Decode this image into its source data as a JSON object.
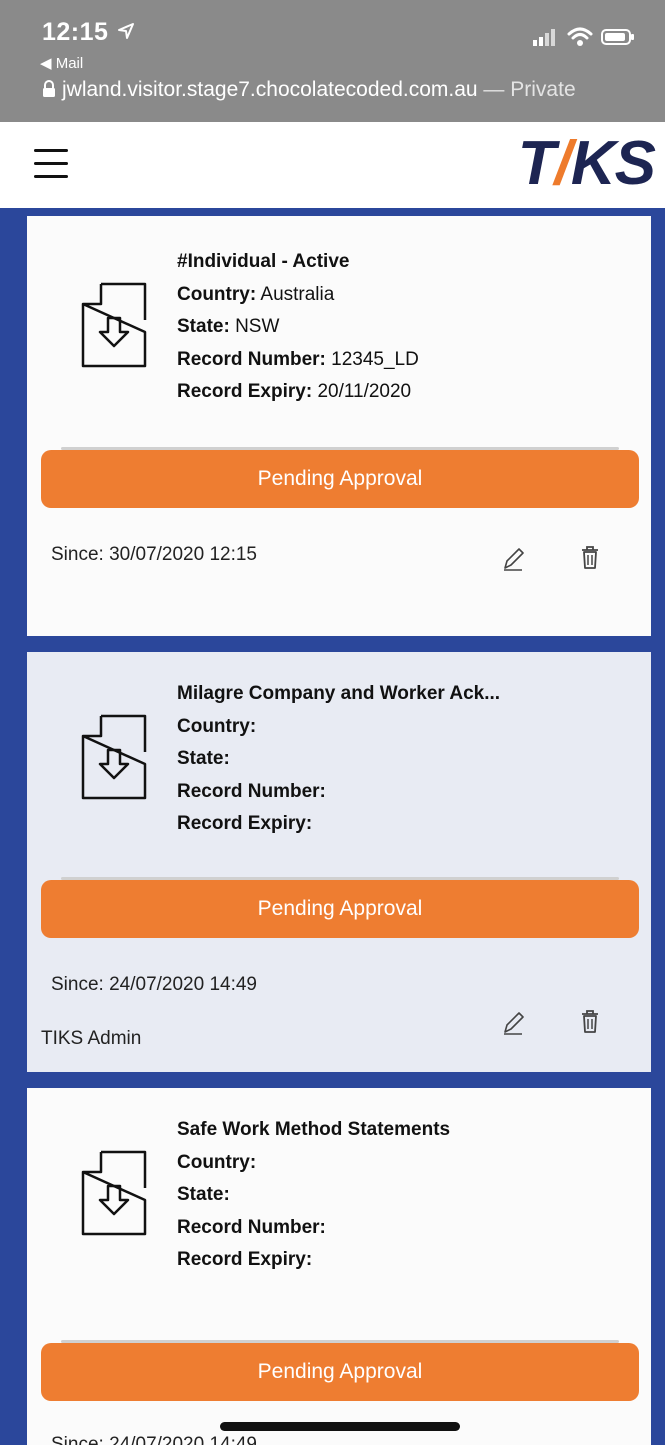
{
  "status_bar": {
    "time": "12:15",
    "back_label": "◀ Mail",
    "url": "jwland.visitor.stage7.chocolatecoded.com.au",
    "url_suffix": " — Private"
  },
  "header": {
    "logo_left": "T",
    "logo_slash": "/",
    "logo_right": "KS",
    "accent_color": "#ee7b2c",
    "brand_color": "#1d2552"
  },
  "records": [
    {
      "title": "#Individual - Active",
      "country_label": "Country:",
      "country": "Australia",
      "state_label": "State:",
      "state": "NSW",
      "number_label": "Record Number:",
      "number": "12345_LD",
      "expiry_label": "Record Expiry:",
      "expiry": "20/11/2020",
      "status": "Pending Approval",
      "since": "Since: 30/07/2020 12:15",
      "owner": ""
    },
    {
      "title": "Milagre Company and Worker Ack...",
      "country_label": "Country:",
      "country": "",
      "state_label": "State:",
      "state": "",
      "number_label": "Record Number:",
      "number": "",
      "expiry_label": "Record Expiry:",
      "expiry": "",
      "status": "Pending Approval",
      "since": "Since: 24/07/2020 14:49",
      "owner": "TIKS Admin"
    },
    {
      "title": "Safe Work Method Statements",
      "country_label": "Country:",
      "country": "",
      "state_label": "State:",
      "state": "",
      "number_label": "Record Number:",
      "number": "",
      "expiry_label": "Record Expiry:",
      "expiry": "",
      "status": "Pending Approval",
      "since": "Since: 24/07/2020 14:49",
      "owner": ""
    }
  ],
  "icons": {
    "menu": "hamburger-icon",
    "document": "document-download-icon",
    "edit": "pencil-icon",
    "delete": "trash-icon"
  }
}
